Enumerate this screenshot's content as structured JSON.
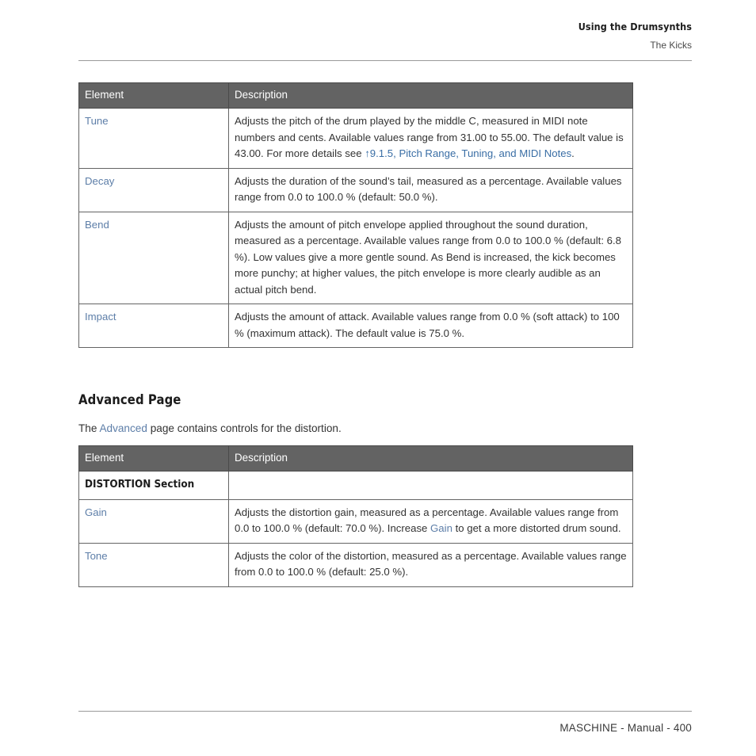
{
  "header": {
    "chapter": "Using the Drumsynths",
    "section": "The Kicks"
  },
  "colors": {
    "table_header_bg": "#636363",
    "table_header_text": "#ffffff",
    "element_link": "#5d7ea8",
    "cross_reference_link": "#3a6ea5",
    "rule": "#9a9a9a",
    "body_text": "#333333"
  },
  "tables": {
    "parameters": {
      "columns": [
        "Element",
        "Description"
      ],
      "rows": [
        {
          "element": "Tune",
          "element_is_link": true,
          "description_parts": [
            {
              "text": "Adjusts the pitch of the drum played by the middle C, measured in MIDI note numbers and cents. Available values range from 31.00 to 55.00. The default value is 43.00. For more details see ",
              "type": "text"
            },
            {
              "text": "↑9.1.5, Pitch Range, Tuning, and MIDI Notes",
              "type": "xref"
            },
            {
              "text": ".",
              "type": "text"
            }
          ]
        },
        {
          "element": "Decay",
          "element_is_link": true,
          "description_parts": [
            {
              "text": "Adjusts the duration of the sound’s tail, measured as a percentage. Available values range from 0.0 to 100.0 % (default: 50.0 %).",
              "type": "text"
            }
          ]
        },
        {
          "element": "Bend",
          "element_is_link": true,
          "description_parts": [
            {
              "text": "Adjusts the amount of pitch envelope applied throughout the sound duration, measured as a percentage. Available values range from 0.0 to 100.0 % (default: 6.8 %). Low values give a more gentle sound. As Bend is increased, the kick becomes more punchy; at higher values, the pitch envelope is more clearly audible as an actual pitch bend.",
              "type": "text"
            }
          ]
        },
        {
          "element": "Impact",
          "element_is_link": true,
          "description_parts": [
            {
              "text": "Adjusts the amount of attack. Available values range from 0.0 % (soft attack) to 100 % (maximum attack). The default value is 75.0 %.",
              "type": "text"
            }
          ]
        }
      ]
    },
    "advanced": {
      "columns": [
        "Element",
        "Description"
      ],
      "rows": [
        {
          "element": "DISTORTION Section",
          "element_is_section": true,
          "description_parts": []
        },
        {
          "element": "Gain",
          "element_is_link": true,
          "description_parts": [
            {
              "text": "Adjusts the distortion gain, measured as a percentage. Available values range from 0.0 to 100.0 % (default: 70.0 %). Increase ",
              "type": "text"
            },
            {
              "text": "Gain",
              "type": "inline-link"
            },
            {
              "text": " to get a more distorted drum sound.",
              "type": "text"
            }
          ]
        },
        {
          "element": "Tone",
          "element_is_link": true,
          "description_parts": [
            {
              "text": "Adjusts the color of the distortion, measured as a percentage. Available values range from 0.0 to 100.0 % (default: 25.0 %).",
              "type": "text"
            }
          ]
        }
      ]
    }
  },
  "advanced_section": {
    "heading": "Advanced Page",
    "paragraph_parts": [
      {
        "text": "The ",
        "type": "text"
      },
      {
        "text": "Advanced",
        "type": "inline-link"
      },
      {
        "text": " page contains controls for the distortion.",
        "type": "text"
      }
    ]
  },
  "footer": {
    "text": "MASCHINE - Manual - 400"
  }
}
